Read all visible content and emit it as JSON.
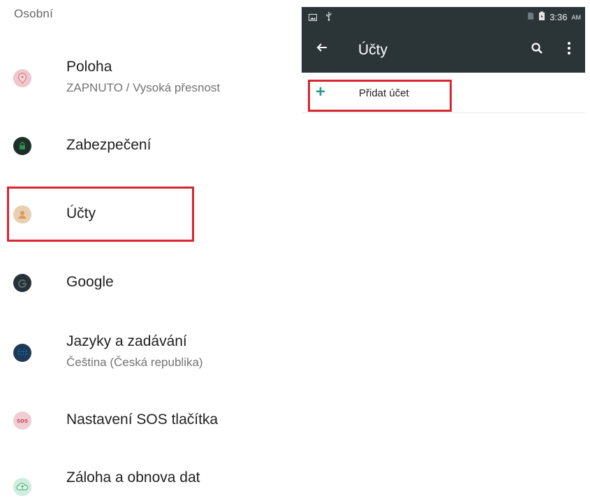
{
  "settings": {
    "section_header": "Osobní",
    "items": [
      {
        "title": "Poloha",
        "subtitle": "ZAPNUTO / Vysoká přesnost",
        "icon": "location-pin-icon",
        "color": "#e9a9b0"
      },
      {
        "title": "Zabezpečení",
        "subtitle": "",
        "icon": "lock-icon",
        "color": "#1f3a2b"
      },
      {
        "title": "Účty",
        "subtitle": "",
        "icon": "account-person-icon",
        "color": "#e2bd8f"
      },
      {
        "title": "Google",
        "subtitle": "",
        "icon": "google-g-icon",
        "color": "#263238"
      },
      {
        "title": "Jazyky a zadávání",
        "subtitle": "Čeština (Česká republika)",
        "icon": "globe-icon",
        "color": "#1f4f78"
      },
      {
        "title": "Nastavení SOS tlačítka",
        "subtitle": "",
        "icon": "sos-icon",
        "color": "#e6a6b1"
      },
      {
        "title": "Záloha a obnova dat",
        "subtitle": "",
        "icon": "cloud-backup-icon",
        "color": "#8fd0a8"
      }
    ]
  },
  "phone": {
    "status": {
      "time": "3:36",
      "ampm": "AM"
    },
    "appbar": {
      "title": "Účty"
    },
    "add_account": {
      "label": "Přidat účet",
      "plus": "+"
    }
  },
  "colors": {
    "highlight": "#d8262f",
    "toolbar": "#2b3538",
    "accent": "#2a9d8f"
  }
}
